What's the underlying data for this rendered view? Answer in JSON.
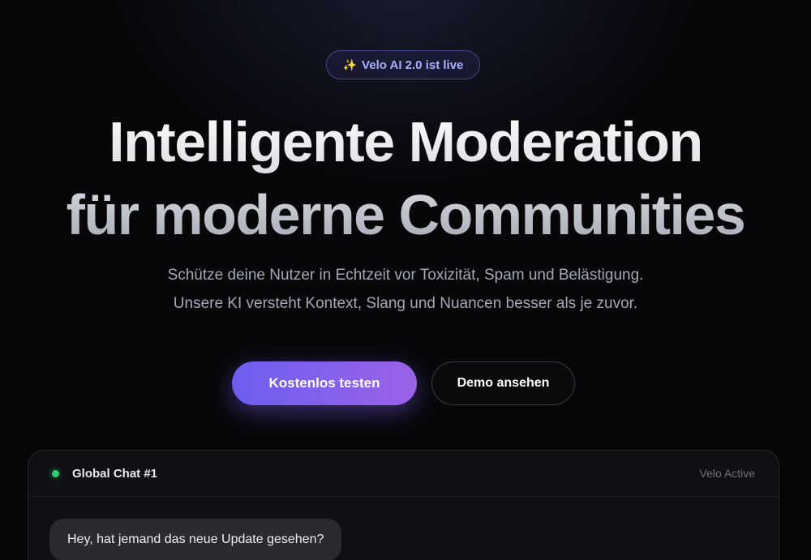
{
  "badge": {
    "icon": "sparkles-icon",
    "label": "Velo AI 2.0 ist live"
  },
  "hero": {
    "title_line1": "Intelligente Moderation",
    "title_line2": "für moderne Communities",
    "subtitle_line1": "Schütze deine Nutzer in Echtzeit vor Toxizität, Spam und Belästigung.",
    "subtitle_line2": "Unsere KI versteht Kontext, Slang und Nuancen besser als je zuvor."
  },
  "cta": {
    "primary_label": "Kostenlos testen",
    "secondary_label": "Demo ansehen"
  },
  "chat": {
    "title": "Global Chat #1",
    "status": "Velo Active",
    "status_color": "#2fce74",
    "messages": [
      {
        "text": "Hey, hat jemand das neue Update gesehen?"
      }
    ]
  },
  "colors": {
    "accent_start": "#6d5ef0",
    "accent_end": "#9b63e8",
    "background": "#07070a"
  }
}
